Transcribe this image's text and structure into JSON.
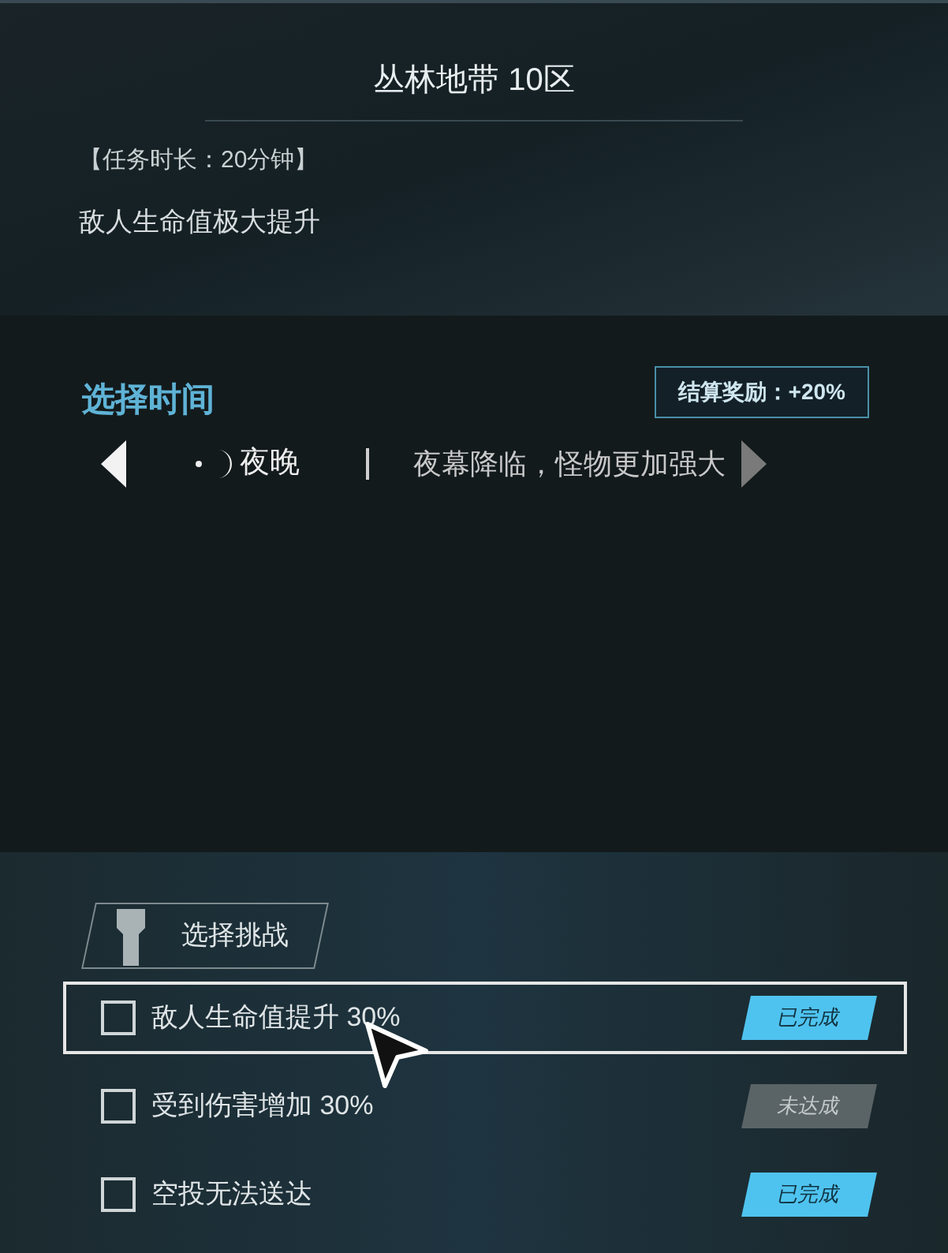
{
  "title": "丛林地带 10区",
  "duration": "【任务时长：20分钟】",
  "modifier": "敌人生命值极大提升",
  "time_select": {
    "heading": "选择时间",
    "reward": "结算奖励：+20%",
    "option": "夜晚",
    "description": "夜幕降临，怪物更加强大"
  },
  "challenges": {
    "heading": "选择挑战",
    "items": [
      {
        "label": "敌人生命值提升 30%",
        "checked": false,
        "selected": true,
        "status": "已完成",
        "kind": "done"
      },
      {
        "label": "受到伤害增加 30%",
        "checked": false,
        "selected": false,
        "status": "未达成",
        "kind": "pending"
      },
      {
        "label": "空投无法送达",
        "checked": false,
        "selected": false,
        "status": "已完成",
        "kind": "done"
      }
    ]
  }
}
